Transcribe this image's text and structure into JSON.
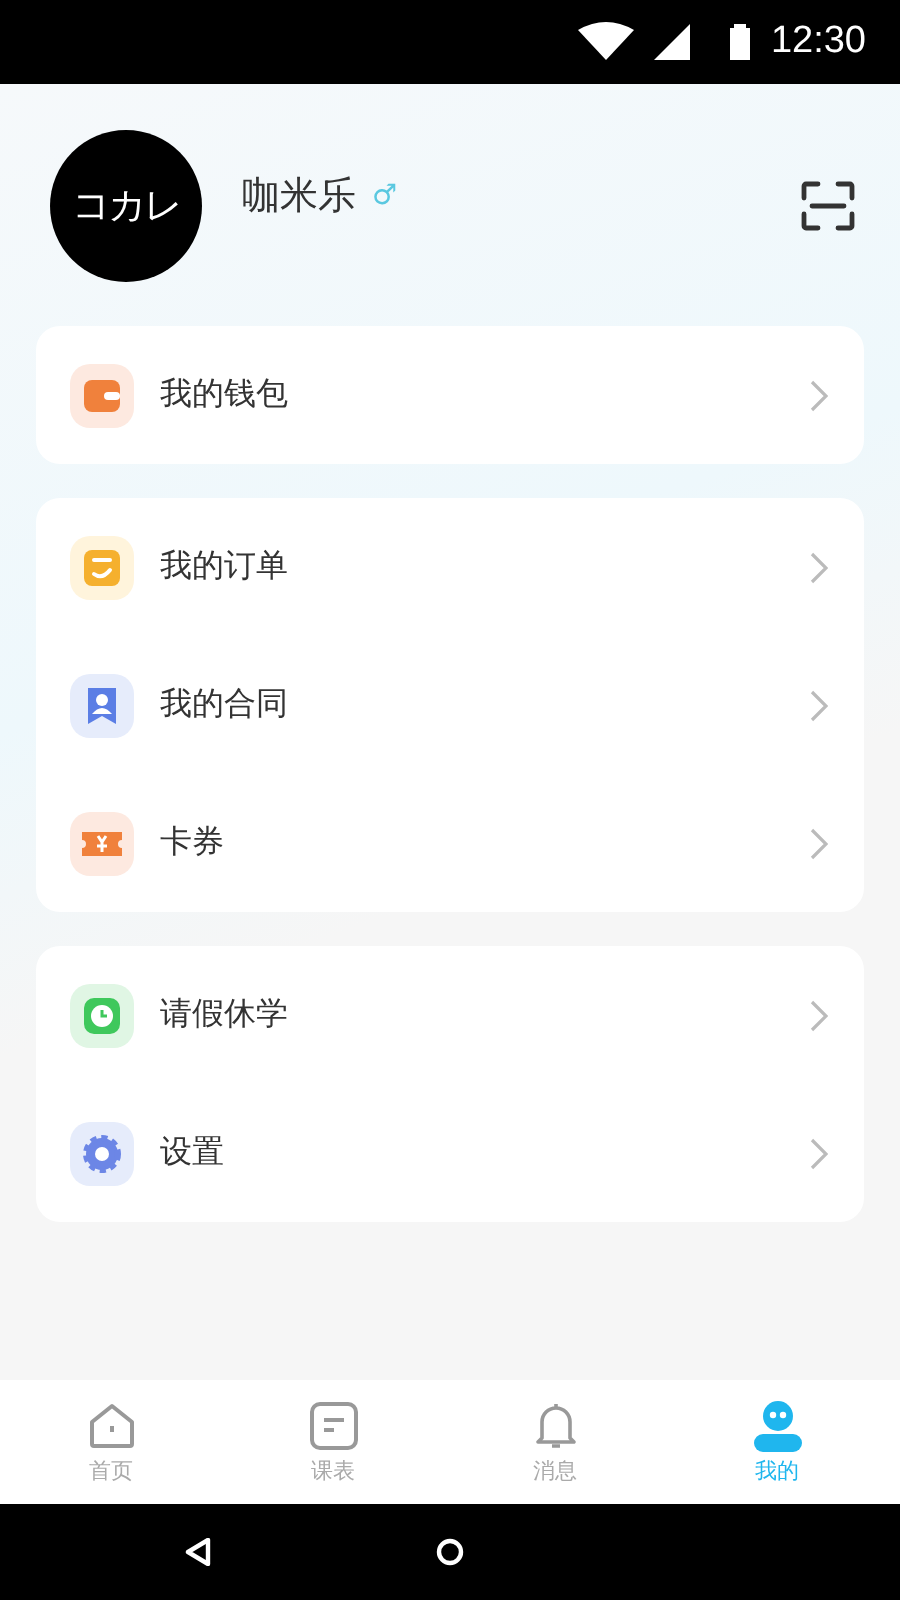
{
  "status_bar": {
    "time": "12:30"
  },
  "profile": {
    "avatar_text": "コカレ",
    "name": "咖米乐",
    "gender": "♂"
  },
  "menu_groups": [
    {
      "items": [
        {
          "kind": "wallet",
          "label": "我的钱包"
        }
      ]
    },
    {
      "items": [
        {
          "kind": "order",
          "label": "我的订单"
        },
        {
          "kind": "contract",
          "label": "我的合同"
        },
        {
          "kind": "coupon",
          "label": "卡券"
        }
      ]
    },
    {
      "items": [
        {
          "kind": "leave",
          "label": "请假休学"
        },
        {
          "kind": "settings",
          "label": "设置"
        }
      ]
    }
  ],
  "tabs": [
    {
      "kind": "home",
      "label": "首页",
      "selected": false
    },
    {
      "kind": "schedule",
      "label": "课表",
      "selected": false
    },
    {
      "kind": "messages",
      "label": "消息",
      "selected": false
    },
    {
      "kind": "mine",
      "label": "我的",
      "selected": true
    }
  ]
}
